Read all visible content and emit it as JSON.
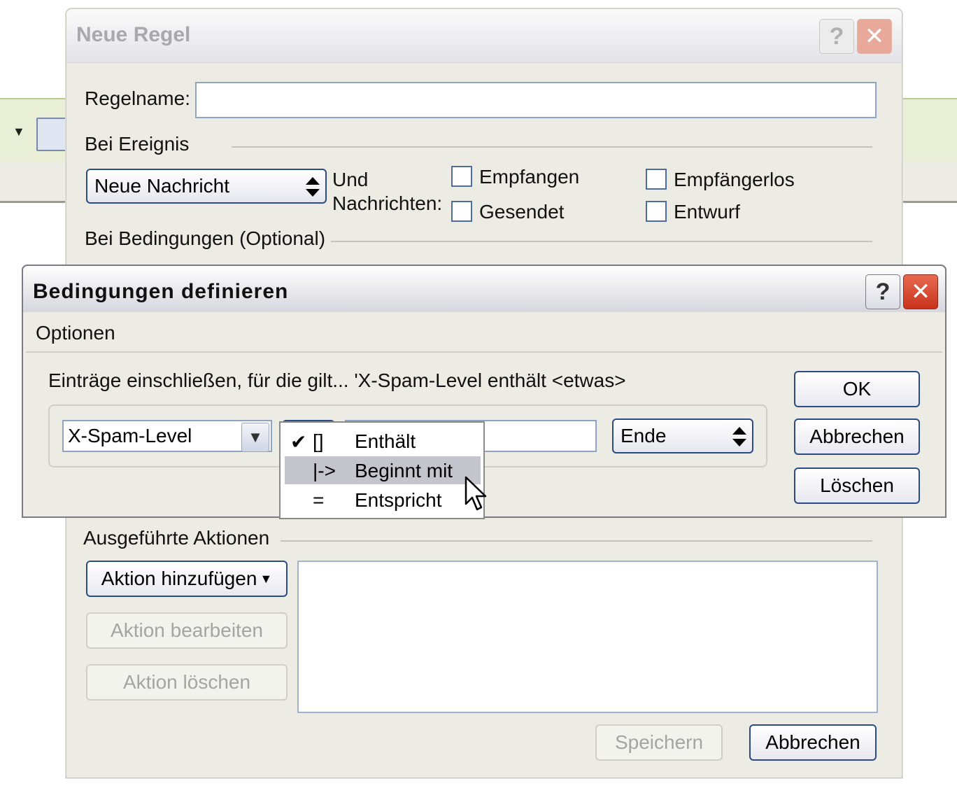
{
  "background": {
    "dropdown_arrow": "▼",
    "app_icon": "window-icon"
  },
  "main_window": {
    "title": "Neue Regel",
    "help_label": "?",
    "close_label": "✕",
    "rule_name_label": "Regelname:",
    "rule_name_value": "",
    "event_section": "Bei Ereignis",
    "event_select": "Neue Nachricht",
    "und_label": "Und",
    "nachrichten_label": "Nachrichten:",
    "checkboxes": [
      {
        "label": "Empfangen",
        "checked": false
      },
      {
        "label": "Gesendet",
        "checked": false
      },
      {
        "label": "Empfängerlos",
        "checked": false
      },
      {
        "label": "Entwurf",
        "checked": false
      }
    ],
    "conditions_section": "Bei Bedingungen  (Optional)",
    "actions_section": "Ausgeführte Aktionen",
    "add_action": "Aktion hinzufügen",
    "edit_action": "Aktion bearbeiten",
    "delete_action": "Aktion löschen",
    "save": "Speichern",
    "cancel": "Abbrechen"
  },
  "dialog": {
    "title": "Bedingungen definieren",
    "help_label": "?",
    "close_label": "✕",
    "menu": "Optionen",
    "description": "Einträge einschließen, für die gilt... 'X-Spam-Level  enthält <etwas>",
    "field_combo": "X-Spam-Level",
    "value_input": "",
    "end_select": "Ende",
    "ok": "OK",
    "cancel": "Abbrechen",
    "delete": "Löschen",
    "operator_menu": [
      {
        "mark": "✔",
        "symbol": "[]",
        "label": "Enthält",
        "selected": false
      },
      {
        "mark": "",
        "symbol": "|->",
        "label": "Beginnt mit",
        "selected": true
      },
      {
        "mark": "",
        "symbol": "=",
        "label": "Entspricht",
        "selected": false
      }
    ]
  },
  "colors": {
    "accent_border": "#2c4a86",
    "close_red": "#c8331b",
    "menu_highlight": "#c4c4cc"
  }
}
